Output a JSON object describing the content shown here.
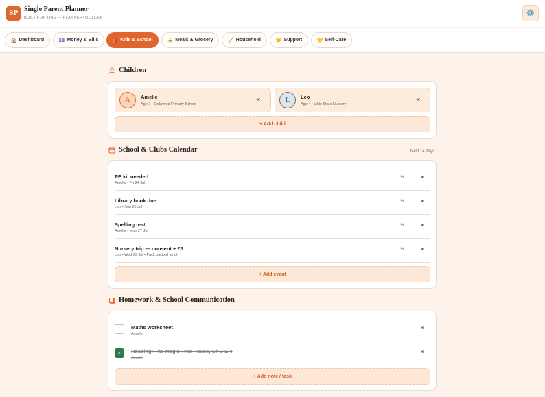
{
  "app": {
    "logo": "SP",
    "title": "Single Parent Planner",
    "subtitle": "BUILT FOR ONE — PLANNERTOOLLAB",
    "settings_icon": "⚙️"
  },
  "tabs": [
    {
      "icon": "🏠",
      "label": "Dashboard",
      "active": false
    },
    {
      "icon": "💷",
      "label": "Money & Bills",
      "active": false
    },
    {
      "icon": "🎒",
      "label": "Kids & School",
      "active": true
    },
    {
      "icon": "🍝",
      "label": "Meals & Grocery",
      "active": false
    },
    {
      "icon": "🧹",
      "label": "Household",
      "active": false
    },
    {
      "icon": "🤝",
      "label": "Support",
      "active": false
    },
    {
      "icon": "💛",
      "label": "Self-Care",
      "active": false
    }
  ],
  "children_section": {
    "title": "Children",
    "children": [
      {
        "initial": "A",
        "name": "Amelie",
        "meta": "Age 7 • Oakwood Primary School"
      },
      {
        "initial": "L",
        "name": "Leo",
        "meta": "Age 4 • Little Stars Nursery"
      }
    ],
    "add_label": "+ Add child"
  },
  "calendar_section": {
    "title": "School & Clubs Calendar",
    "range": "Next 14 days",
    "events": [
      {
        "title": "PE kit needed",
        "meta": "Amelie • Fri 24 Jul"
      },
      {
        "title": "Library book due",
        "meta": "Leo • Sun 26 Jul"
      },
      {
        "title": "Spelling test",
        "meta": "Amelie • Mon 27 Jul"
      },
      {
        "title": "Nursery trip — consent + £5",
        "meta": "Leo • Wed 29 Jul • Pack packed lunch"
      }
    ],
    "add_label": "+ Add event"
  },
  "homework_section": {
    "title": "Homework & School Communication",
    "items": [
      {
        "title": "Maths worksheet",
        "child": "Amelie",
        "done": false
      },
      {
        "title": "Reading: The Magic Tree House, Ch 3 & 4",
        "child": "Amelie",
        "done": true
      }
    ],
    "add_label": "+ Add note / task"
  },
  "glyphs": {
    "close": "✕",
    "edit": "✎",
    "check": "✓"
  },
  "colors": {
    "accent": "#e0662f",
    "background": "#fdf3ea",
    "done_green": "#2f7a4c"
  }
}
